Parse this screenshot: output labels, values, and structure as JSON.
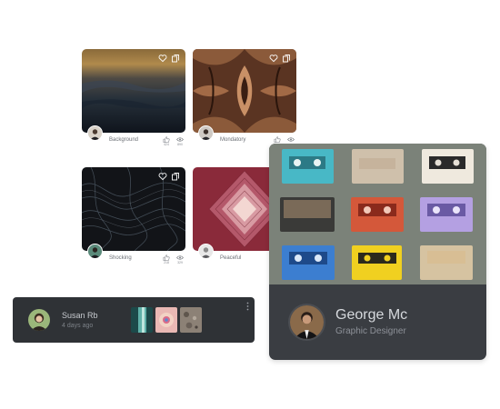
{
  "gallery": {
    "items": [
      {
        "name": "Background",
        "likes": "424",
        "views": "890"
      },
      {
        "name": "Mondatory",
        "likes": "",
        "views": ""
      },
      {
        "name": "Shocking",
        "likes": "218",
        "views": "329"
      },
      {
        "name": "Peaceful",
        "likes": "",
        "views": ""
      }
    ]
  },
  "comment": {
    "user": "Susan Rb",
    "time": "4 days ago"
  },
  "profile": {
    "name": "George Mc",
    "role": "Graphic Designer"
  },
  "icons": {
    "overlay": [
      "heart-icon",
      "copy-icon"
    ],
    "stats": [
      "thumbs-up-icon",
      "eye-icon"
    ],
    "menu": "more-vertical-icon"
  },
  "colors": {
    "card_dark": "#2f3236",
    "profile_footer": "#3a3d42",
    "text_muted": "#6a6e74"
  }
}
